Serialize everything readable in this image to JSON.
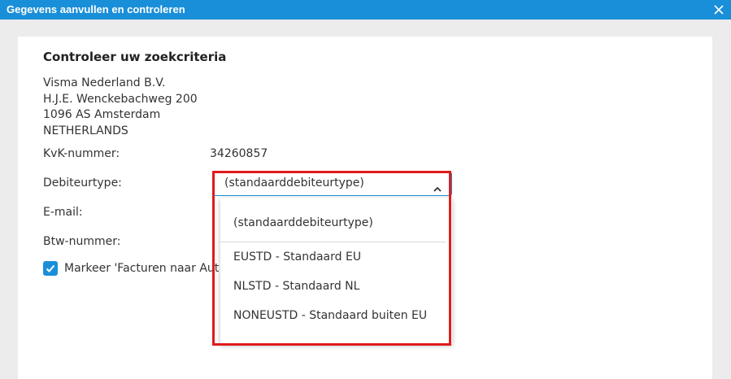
{
  "dialog": {
    "title": "Gegevens aanvullen en controleren",
    "close_icon": "close-icon"
  },
  "form": {
    "heading": "Controleer uw zoekcriteria",
    "address": [
      "Visma Nederland B.V.",
      "H.J.E. Wenckebachweg 200",
      "1096 AS Amsterdam",
      "NETHERLANDS"
    ],
    "kvk_label": "KvK-nummer:",
    "kvk_value": "34260857",
    "debtor_label": "Debiteurtype:",
    "debtor_selected": "(standaarddebiteurtype)",
    "email_label": "E-mail:",
    "btw_label": "Btw-nummer:",
    "checkbox_label": "Markeer 'Facturen naar Aut",
    "checkbox_checked": true
  },
  "dropdown": {
    "options": [
      "(standaarddebiteurtype)",
      "EUSTD - Standaard EU",
      "NLSTD - Standaard NL",
      "NONEUSTD - Standaard buiten EU"
    ]
  },
  "colors": {
    "accent": "#1a8fd9",
    "highlight": "#e01b1b",
    "background": "#ececec"
  }
}
